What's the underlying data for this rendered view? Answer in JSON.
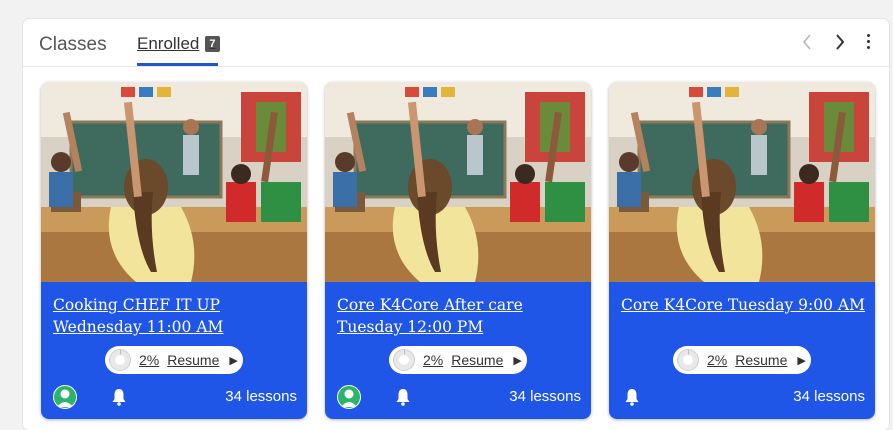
{
  "header": {
    "title": "Classes",
    "tab_label": "Enrolled",
    "tab_count": "7",
    "prev_icon": "chevron-left-icon",
    "next_icon": "chevron-right-icon",
    "more_icon": "more-vertical-icon"
  },
  "colors": {
    "accent": "#1f56e8",
    "tab_underline": "#1f56c9",
    "avatar": "#2bb46a"
  },
  "cards": [
    {
      "title": "Cooking CHEF IT UP Wednesday 11:00 AM",
      "progress_label": "2%",
      "progress_fraction": 0.02,
      "resume_label": "Resume",
      "lessons": "34 lessons",
      "has_avatar": true
    },
    {
      "title": "Core K4Core After care Tuesday 12:00 PM",
      "progress_label": "2%",
      "progress_fraction": 0.02,
      "resume_label": "Resume",
      "lessons": "34 lessons",
      "has_avatar": true
    },
    {
      "title": "Core K4Core Tuesday 9:00 AM",
      "progress_label": "2%",
      "progress_fraction": 0.02,
      "resume_label": "Resume",
      "lessons": "34 lessons",
      "has_avatar": false
    }
  ]
}
